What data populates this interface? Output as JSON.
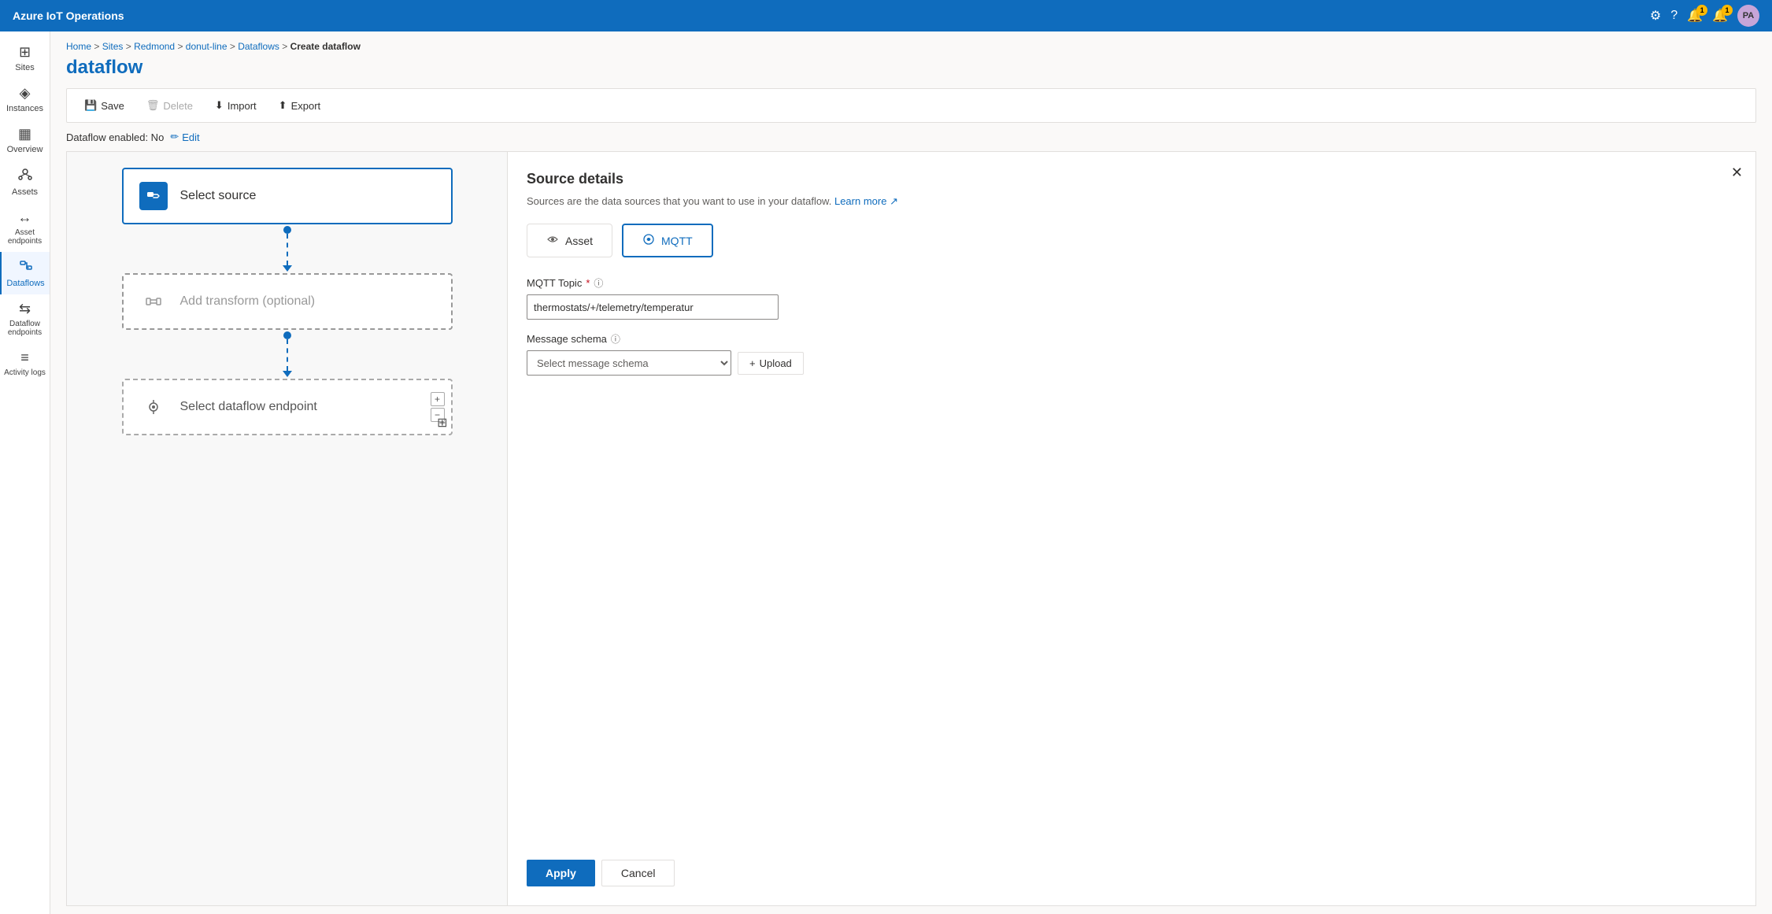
{
  "app": {
    "title": "Azure IoT Operations"
  },
  "topnav": {
    "title": "Azure IoT Operations",
    "icons": {
      "settings": "⚙",
      "help": "?",
      "alerts1": "🔔",
      "alerts2": "🔔",
      "avatar": "PA"
    },
    "badge1": "1",
    "badge2": "1"
  },
  "sidebar": {
    "items": [
      {
        "id": "sites",
        "label": "Sites",
        "icon": "⊞"
      },
      {
        "id": "instances",
        "label": "Instances",
        "icon": "◈"
      },
      {
        "id": "overview",
        "label": "Overview",
        "icon": "▦"
      },
      {
        "id": "assets",
        "label": "Assets",
        "icon": "⚙"
      },
      {
        "id": "asset-endpoints",
        "label": "Asset endpoints",
        "icon": "↔"
      },
      {
        "id": "dataflows",
        "label": "Dataflows",
        "icon": "⇌",
        "active": true
      },
      {
        "id": "dataflow-endpoints",
        "label": "Dataflow endpoints",
        "icon": "⇆"
      },
      {
        "id": "activity-logs",
        "label": "Activity logs",
        "icon": "≡"
      }
    ]
  },
  "breadcrumb": {
    "parts": [
      "Home",
      "Sites",
      "Redmond",
      "donut-line",
      "Dataflows"
    ],
    "current": "Create dataflow"
  },
  "page": {
    "title": "dataflow"
  },
  "toolbar": {
    "save": "Save",
    "delete": "Delete",
    "import": "Import",
    "export": "Export"
  },
  "status": {
    "label": "Dataflow enabled: No",
    "edit": "Edit"
  },
  "flow": {
    "source_label": "Select source",
    "transform_label": "Add transform (optional)",
    "endpoint_label": "Select dataflow endpoint"
  },
  "details": {
    "title": "Source details",
    "subtitle": "Sources are the data sources that you want to use in your dataflow.",
    "learn_more": "Learn more",
    "asset_btn": "Asset",
    "mqtt_btn": "MQTT",
    "mqtt_topic_label": "MQTT Topic",
    "mqtt_topic_value": "thermostats/+/telemetry/temperatur",
    "message_schema_label": "Message schema",
    "message_schema_placeholder": "Select message schema",
    "upload_btn": "Upload",
    "apply_btn": "Apply",
    "cancel_btn": "Cancel"
  }
}
